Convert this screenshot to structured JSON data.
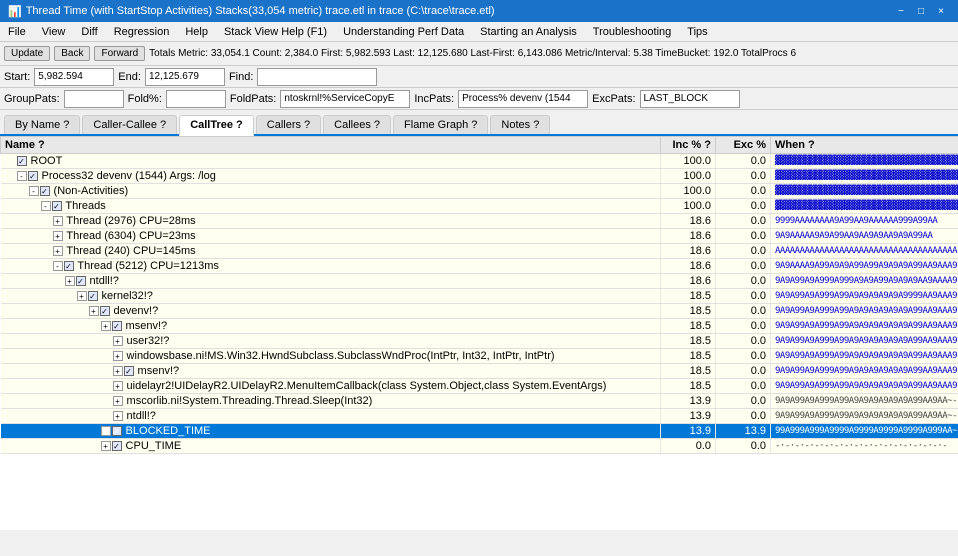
{
  "titleBar": {
    "title": "Thread Time (with StartStop Activities) Stacks(33,054 metric) trace.etl in trace (C:\\trace\\trace.etl)",
    "minLabel": "−",
    "maxLabel": "□",
    "closeLabel": "×"
  },
  "menuBar": {
    "items": [
      "File",
      "View",
      "Diff",
      "Regression",
      "Help",
      "Stack View Help (F1)",
      "Understanding Perf Data",
      "Starting an Analysis",
      "Troubleshooting",
      "Tips"
    ]
  },
  "toolbar": {
    "updateLabel": "Update",
    "backLabel": "Back",
    "forwardLabel": "Forward",
    "statsText": "Totals Metric: 33,054.1  Count: 2,384.0  First: 5,982.593  Last: 12,125.680  Last-First: 6,143.086  Metric/Interval: 5.38  TimeBucket: 192.0  TotalProcs 6"
  },
  "filterRow": {
    "startLabel": "Start:",
    "startValue": "5,982.594",
    "endLabel": "End:",
    "endValue": "12,125.679",
    "findLabel": "Find:",
    "findValue": ""
  },
  "foldRow": {
    "groupPatsLabel": "GroupPats:",
    "foldLabel": "Fold%:",
    "foldValue": "",
    "foldPatsLabel": "FoldPats:",
    "foldPatsValue": "ntoskrnl!%ServiceCopyE",
    "incPatsLabel": "IncPats:",
    "incPatsValue": "Process% devenv (1544",
    "excPatsLabel": "ExcPats:",
    "excPatsValue": "LAST_BLOCK"
  },
  "tabs": {
    "items": [
      "By Name ?",
      "Caller-Callee ?",
      "CallTree ?",
      "Callers ?",
      "Callees ?",
      "Flame Graph ?",
      "Notes ?"
    ],
    "activeIndex": 2
  },
  "tableHeader": {
    "nameLabel": "Name ?",
    "incLabel": "Inc %  ?",
    "excLabel": "Exc %",
    "whenLabel": "When ?"
  },
  "rows": [
    {
      "indent": 0,
      "expander": "",
      "checkbox": true,
      "checked": true,
      "label": "ROOT",
      "inc": "100.0",
      "exc": "0.0",
      "when": "▓▓▓▓▓▓▓▓▓▓▓▓▓▓▓▓▓▓▓▓▓▓▓▓▓▓▓▓▓▓▓▓▓▓▓▓▓▓",
      "whenType": "blue",
      "rowClass": "row-normal"
    },
    {
      "indent": 1,
      "expander": "-",
      "checkbox": true,
      "checked": true,
      "label": "Process32 devenv (1544) Args:  /log",
      "inc": "100.0",
      "exc": "0.0",
      "when": "▓▓▓▓▓▓▓▓▓▓▓▓▓▓▓▓▓▓▓▓▓▓▓▓▓▓▓▓▓▓▓▓▓▓▓▓▓▓",
      "whenType": "blue",
      "rowClass": "row-normal"
    },
    {
      "indent": 2,
      "expander": "-",
      "checkbox": true,
      "checked": true,
      "label": "(Non-Activities)",
      "inc": "100.0",
      "exc": "0.0",
      "when": "▓▓▓▓▓▓▓▓▓▓▓▓▓▓▓▓▓▓▓▓▓▓▓▓▓▓▓▓▓▓▓▓▓▓▓▓▓▓",
      "whenType": "blue",
      "rowClass": "row-normal"
    },
    {
      "indent": 3,
      "expander": "-",
      "checkbox": true,
      "checked": true,
      "label": "Threads",
      "inc": "100.0",
      "exc": "0.0",
      "when": "▓▓▓▓▓▓▓▓▓▓▓▓▓▓▓▓▓▓▓▓▓▓▓▓▓▓▓▓▓▓▓▓▓▓▓▓▓▓",
      "whenType": "blue",
      "rowClass": "row-normal"
    },
    {
      "indent": 4,
      "expander": "+",
      "checkbox": false,
      "checked": false,
      "label": "Thread (2976) CPU=28ms",
      "inc": "18.6",
      "exc": "0.0",
      "when": "9999AAAAAAAA9A99AA9AAAAAA999A99AA",
      "whenType": "blue",
      "rowClass": "row-normal"
    },
    {
      "indent": 4,
      "expander": "+",
      "checkbox": false,
      "checked": false,
      "label": "Thread (6304) CPU=23ms",
      "inc": "18.6",
      "exc": "0.0",
      "when": "9A9AAAAA9A9A99AA9AA9A9AA9A9A99AA",
      "whenType": "blue",
      "rowClass": "row-normal"
    },
    {
      "indent": 4,
      "expander": "+",
      "checkbox": false,
      "checked": false,
      "label": "Thread (240) CPU=145ms",
      "inc": "18.6",
      "exc": "0.0",
      "when": "AAAAAAAAAAAAAAAAAAAAAAAAAAAAAAAAAAAAA",
      "whenType": "blue",
      "rowClass": "row-normal"
    },
    {
      "indent": 4,
      "expander": "-",
      "checkbox": true,
      "checked": true,
      "label": "Thread (5212) CPU=1213ms",
      "inc": "18.6",
      "exc": "0.0",
      "when": "9A9AAAA9A99A9A9A99A99A9A9A9A99AA9AAA9",
      "whenType": "blue",
      "rowClass": "row-normal"
    },
    {
      "indent": 5,
      "expander": "+",
      "checkbox": true,
      "checked": true,
      "label": "ntdll!?",
      "inc": "18.6",
      "exc": "0.0",
      "when": "9A9A99A9A999A999A9A9A99A9A9A9AA9AAAA9",
      "whenType": "blue",
      "rowClass": "row-normal"
    },
    {
      "indent": 6,
      "expander": "+",
      "checkbox": true,
      "checked": true,
      "label": "kernel32!?",
      "inc": "18.5",
      "exc": "0.0",
      "when": "9A9A99A9A999A99A9A9A9A9A9A9999AA9AAA9",
      "whenType": "blue",
      "rowClass": "row-normal"
    },
    {
      "indent": 7,
      "expander": "+",
      "checkbox": true,
      "checked": true,
      "label": "devenv!?",
      "inc": "18.5",
      "exc": "0.0",
      "when": "9A9A99A9A999A99A9A9A9A9A9A9A99AA9AAA9",
      "whenType": "blue",
      "rowClass": "row-normal"
    },
    {
      "indent": 8,
      "expander": "+",
      "checkbox": true,
      "checked": true,
      "label": "msenv!?",
      "inc": "18.5",
      "exc": "0.0",
      "when": "9A9A99A9A999A99A9A9A9A9A9A9A99AA9AAA9",
      "whenType": "blue",
      "rowClass": "row-normal"
    },
    {
      "indent": 9,
      "expander": "+",
      "checkbox": false,
      "checked": false,
      "label": "user32!?",
      "inc": "18.5",
      "exc": "0.0",
      "when": "9A9A99A9A999A99A9A9A9A9A9A9A99AA9AAA9",
      "whenType": "blue",
      "rowClass": "row-normal"
    },
    {
      "indent": 9,
      "expander": "+",
      "checkbox": false,
      "checked": false,
      "label": "windowsbase.ni!MS.Win32.HwndSubclass.SubclassWndProc(IntPtr, Int32, IntPtr, IntPtr)",
      "inc": "18.5",
      "exc": "0.0",
      "when": "9A9A99A9A999A99A9A9A9A9A9A9A99AA9AAA9",
      "whenType": "blue",
      "rowClass": "row-normal"
    },
    {
      "indent": 9,
      "expander": "+",
      "checkbox": true,
      "checked": true,
      "label": "msenv!?",
      "inc": "18.5",
      "exc": "0.0",
      "when": "9A9A99A9A999A99A9A9A9A9A9A9A99AA9AAA9",
      "whenType": "blue",
      "rowClass": "row-normal"
    },
    {
      "indent": 9,
      "expander": "+",
      "checkbox": false,
      "checked": false,
      "label": "uidelayr2!UIDelayR2.UIDelayR2.MenuItemCallback(class System.Object,class System.EventArgs)",
      "inc": "18.5",
      "exc": "0.0",
      "when": "9A9A99A9A999A99A9A9A9A9A9A9A99AA9AAA9",
      "whenType": "blue",
      "rowClass": "row-normal"
    },
    {
      "indent": 9,
      "expander": "+",
      "checkbox": false,
      "checked": false,
      "label": "mscorlib.ni!System.Threading.Thread.Sleep(Int32)",
      "inc": "13.9",
      "exc": "0.0",
      "when": "9A9A99A9A999A99A9A9A9A9A9A9A99AA9AA~-",
      "whenType": "dash",
      "rowClass": "row-normal"
    },
    {
      "indent": 9,
      "expander": "+",
      "checkbox": false,
      "checked": false,
      "label": "ntdll!?",
      "inc": "13.9",
      "exc": "0.0",
      "when": "9A9A99A9A999A99A9A9A9A9A9A9A99AA9AA~-",
      "whenType": "dash",
      "rowClass": "row-normal"
    },
    {
      "indent": 8,
      "expander": "+",
      "checkbox": true,
      "checked": true,
      "label": "BLOCKED_TIME",
      "inc": "13.9",
      "exc": "13.9",
      "when": "99A999A999A9999A9999A9999A9999A999AA~-",
      "whenType": "dash",
      "rowClass": "row-selected",
      "isSelected": true
    },
    {
      "indent": 8,
      "expander": "+",
      "checkbox": true,
      "checked": true,
      "label": "CPU_TIME",
      "inc": "0.0",
      "exc": "0.0",
      "when": "-·-·-·-·-·-·-·-·-·-·-·-·-·-·-·-·-·-",
      "whenType": "dash",
      "rowClass": "row-normal"
    }
  ]
}
